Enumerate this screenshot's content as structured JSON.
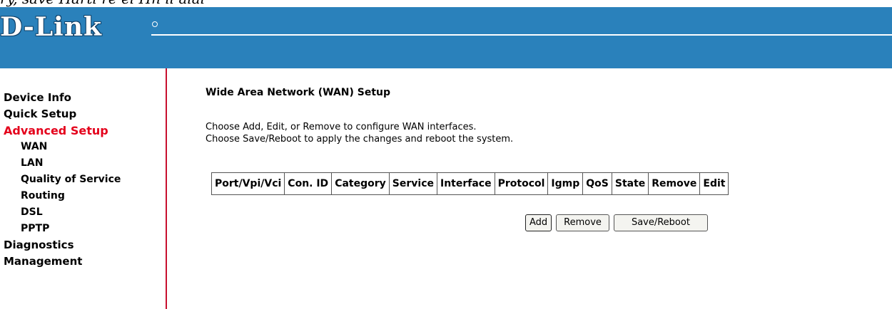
{
  "header": {
    "logo_text": "D-Link",
    "top_strip_text": "ry, save Hartl re el Hn il alal"
  },
  "sidebar": {
    "items": [
      {
        "label": "Device Info"
      },
      {
        "label": "Quick Setup"
      },
      {
        "label": "Advanced Setup",
        "active": true
      },
      {
        "label": "WAN",
        "sub": true
      },
      {
        "label": "LAN",
        "sub": true
      },
      {
        "label": "Quality of Service",
        "sub": true
      },
      {
        "label": "Routing",
        "sub": true
      },
      {
        "label": "DSL",
        "sub": true
      },
      {
        "label": "PPTP",
        "sub": true
      },
      {
        "label": "Diagnostics"
      },
      {
        "label": "Management"
      }
    ],
    "active_color": "#e4001b",
    "border_color": "#c8102e"
  },
  "main": {
    "title": "Wide Area Network (WAN) Setup",
    "description_line1": "Choose Add, Edit, or Remove to configure WAN interfaces.",
    "description_line2": "Choose Save/Reboot to apply the changes and reboot the system.",
    "table": {
      "columns": [
        "Port/Vpi/Vci",
        "Con. ID",
        "Category",
        "Service",
        "Interface",
        "Protocol",
        "Igmp",
        "QoS",
        "State",
        "Remove",
        "Edit"
      ],
      "rows": []
    },
    "buttons": {
      "add": "Add",
      "remove": "Remove",
      "save_reboot": "Save/Reboot"
    }
  },
  "colors": {
    "header_blue": "#2a81bb"
  }
}
